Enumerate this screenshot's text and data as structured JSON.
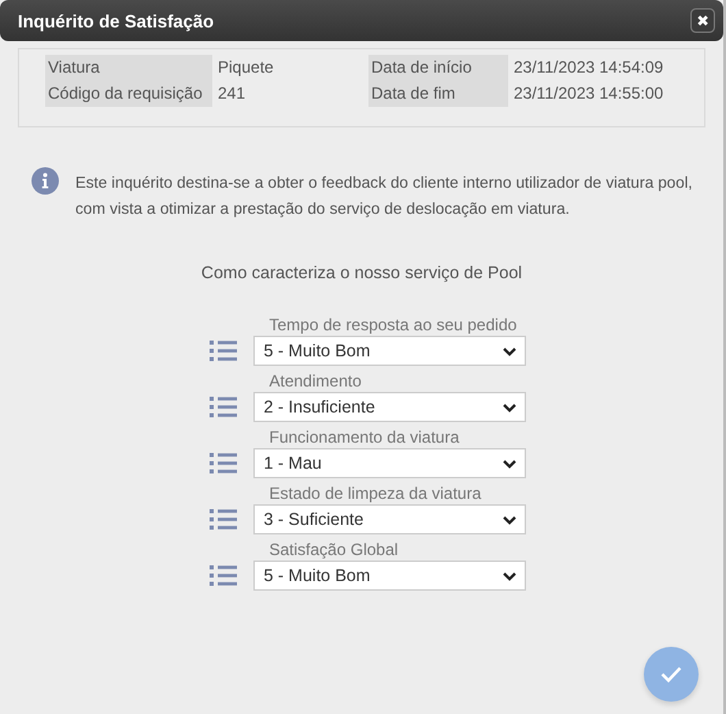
{
  "window": {
    "title": "Inquérito de Satisfação",
    "close_label": "✖"
  },
  "details": [
    {
      "label": "Viatura",
      "value": "Piquete"
    },
    {
      "label": "Data de início",
      "value": "23/11/2023 14:54:09"
    },
    {
      "label": "Código da requisição",
      "value": "241"
    },
    {
      "label": "Data de fim",
      "value": "23/11/2023 14:55:00"
    }
  ],
  "info": "Este inquérito destina-se a obter o feedback do cliente interno utilizador de viatura pool, com vista a otimizar a prestação do serviço de deslocação em viatura.",
  "question": "Como caracteriza o nosso serviço de Pool",
  "ratings": [
    {
      "label": "Tempo de resposta ao seu pedido",
      "value": "5 - Muito Bom"
    },
    {
      "label": "Atendimento",
      "value": "2 - Insuficiente"
    },
    {
      "label": "Funcionamento da viatura",
      "value": "1 - Mau"
    },
    {
      "label": "Estado de limpeza da viatura",
      "value": "3 - Suficiente"
    },
    {
      "label": "Satisfação Global",
      "value": "5 - Muito Bom"
    }
  ]
}
